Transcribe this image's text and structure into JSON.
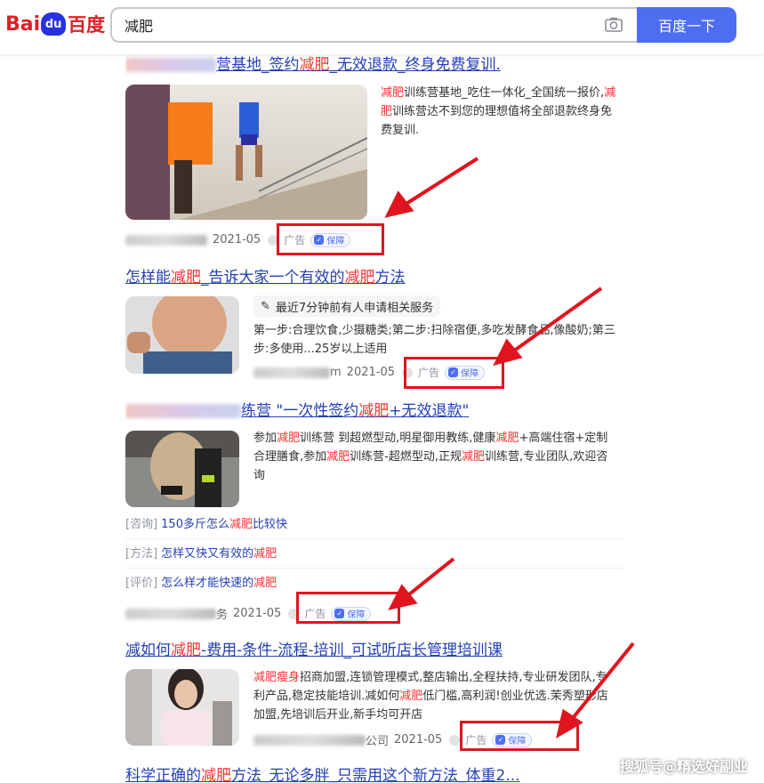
{
  "header": {
    "logo_left": "Bai",
    "logo_paw": "du",
    "logo_cn": "百度",
    "search_value": "减肥",
    "search_button": "百度一下"
  },
  "results": [
    {
      "title_parts": [
        "营基地_签约",
        "减肥",
        "_无效退款_终身免费复训."
      ],
      "snippet_parts": [
        "减肥",
        "训练营基地_吃住一体化_全国统一报价,",
        "减肥",
        "训练营达不到您的理想值将全部退款终身免费复训."
      ],
      "date": "2021-05",
      "ad": "广告",
      "guard": "保障"
    },
    {
      "title_parts": [
        "怎样能",
        "减肥",
        "_告诉大家一个有效的",
        "减肥",
        "方法"
      ],
      "notice": "最近7分钟前有人申请相关服务",
      "snippet": "第一步:合理饮食,少摄糖类;第二步:扫除宿便,多吃发酵食品,像酸奶;第三步:多使用...25岁以上适用",
      "source_tail": "m",
      "date": "2021-05",
      "ad": "广告",
      "guard": "保障"
    },
    {
      "title_parts": [
        "练营 \"一次性签约",
        "减肥",
        "+无效退款\""
      ],
      "snippet_parts": [
        "参加",
        "减肥",
        "训练营 到超燃型动,明星御用教练,健康",
        "减肥",
        "+高端住宿+定制合理膳食,参加",
        "减肥",
        "训练营-超燃型动,正规",
        "减肥",
        "训练营,专业团队,欢迎咨询"
      ],
      "sublinks": [
        {
          "tag": "[咨询]",
          "text": "150多斤怎么",
          "hl": "减肥",
          "tail": "比较快"
        },
        {
          "tag": "[方法]",
          "text": "怎样又快又有效的",
          "hl": "减肥",
          "tail": ""
        },
        {
          "tag": "[评价]",
          "text": "怎么样才能快速的",
          "hl": "减肥",
          "tail": ""
        }
      ],
      "source_tail": "务",
      "date": "2021-05",
      "ad": "广告",
      "guard": "保障"
    },
    {
      "title_parts": [
        "减如何",
        "减肥",
        "-费用-条件-流程-培训_可试听店长管理培训课"
      ],
      "snippet_parts": [
        "减肥瘦身",
        "招商加盟,连锁管理模式,整店输出,全程扶持,专业研发团队,专利产品,稳定技能培训.减如何",
        "减肥",
        "低门槛,高利润!创业优选.茉秀塑形店加盟,先培训后开业,新手均可开店"
      ],
      "source_tail": "公司",
      "date": "2021-05",
      "ad": "广告",
      "guard": "保障"
    },
    {
      "title_parts": [
        "科学正确的",
        "减肥",
        "方法_无论多胖_只需用这个新方法_体重2..."
      ]
    }
  ],
  "watermark": "搜狐号@精选好副业",
  "colors": {
    "accent": "#4e6ef2",
    "link": "#2440b3",
    "highlight": "#f73131",
    "arrow": "#e0141e"
  }
}
